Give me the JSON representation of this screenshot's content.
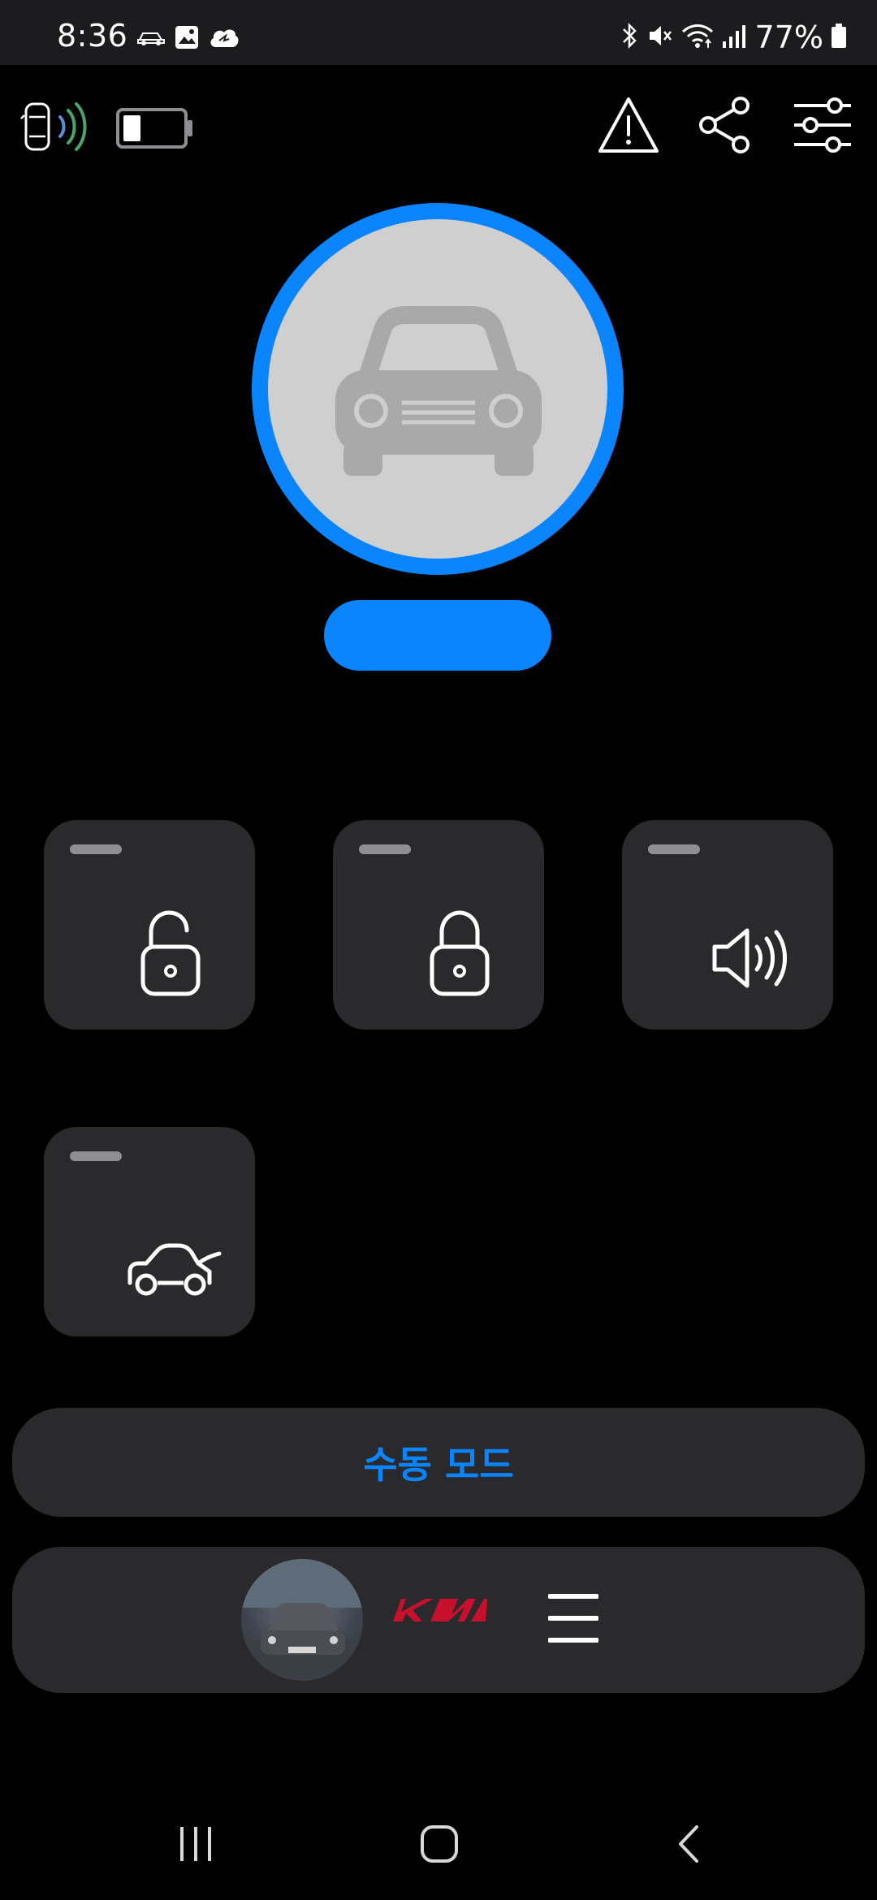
{
  "status_bar": {
    "time": "8:36",
    "battery_percent": "77%",
    "left_icons": [
      "car-notification-icon",
      "gallery-icon",
      "cloud-sync-icon"
    ],
    "right_icons": [
      "bluetooth-icon",
      "mute-icon",
      "wifi-icon",
      "signal-icon",
      "battery-icon"
    ]
  },
  "header": {
    "left_icons": [
      "car-signal-icon",
      "battery-level-icon"
    ],
    "right_icons": [
      "warning-icon",
      "share-icon",
      "settings-sliders-icon"
    ],
    "car_battery_level": 0.3
  },
  "hero": {
    "icon": "car-icon",
    "ring_color": "#0a84ff",
    "status_text": ""
  },
  "tiles": [
    {
      "id": "unlock",
      "icon": "unlock-icon",
      "label": ""
    },
    {
      "id": "lock",
      "icon": "lock-icon",
      "label": ""
    },
    {
      "id": "horn",
      "icon": "speaker-icon",
      "label": ""
    },
    {
      "id": "trunk",
      "icon": "trunk-icon",
      "label": ""
    }
  ],
  "manual_mode": {
    "label": "수동 모드"
  },
  "vehicle_bar": {
    "brand": "KIA",
    "brand_color": "#c8102e",
    "menu_icon": "hamburger-menu-icon"
  },
  "nav": {
    "items": [
      "recents-icon",
      "home-icon",
      "back-icon"
    ]
  },
  "colors": {
    "accent": "#0a84ff",
    "tile_bg": "#2a2a2c",
    "background": "#000000"
  }
}
